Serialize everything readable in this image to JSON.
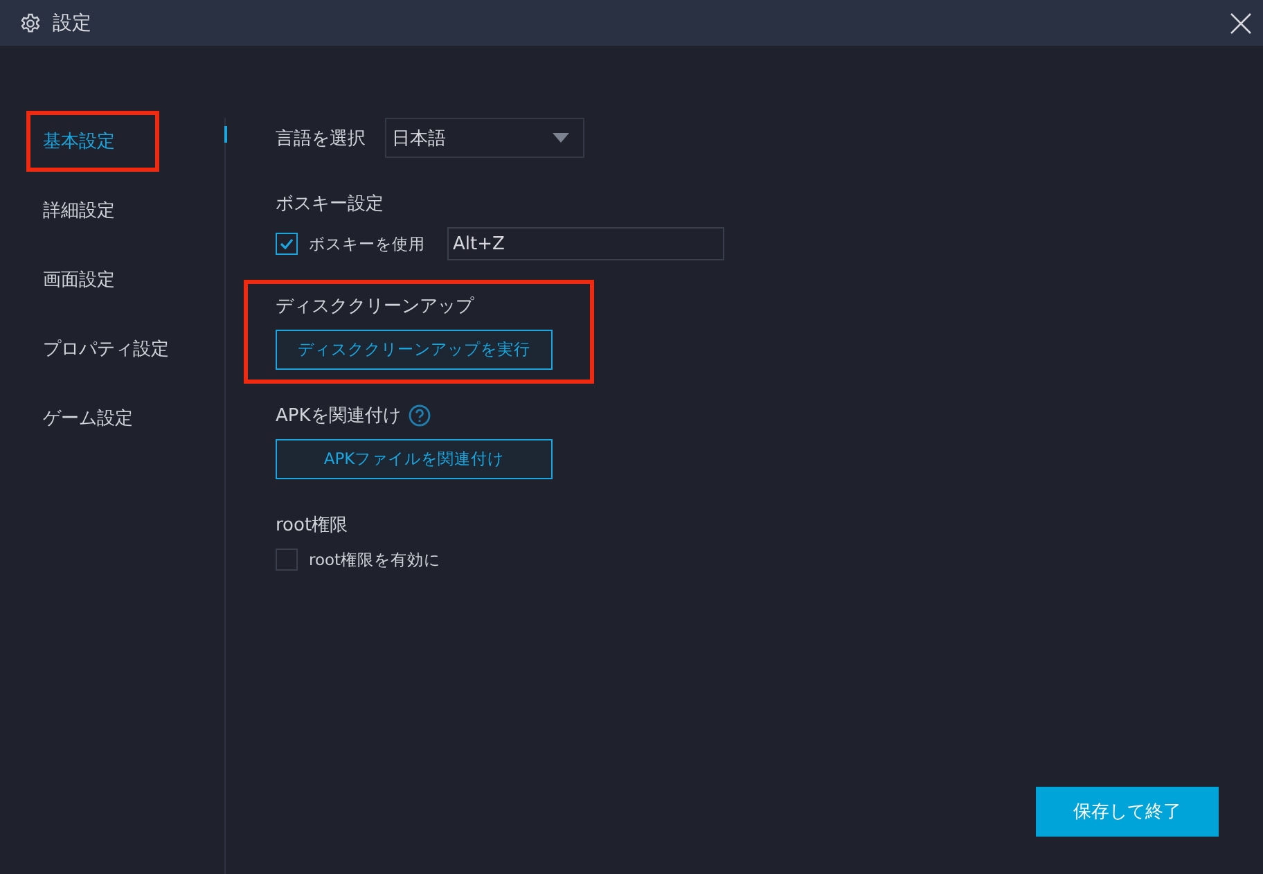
{
  "window": {
    "title": "設定"
  },
  "sidebar": {
    "items": [
      {
        "label": "基本設定",
        "selected": true,
        "highlighted": true
      },
      {
        "label": "詳細設定",
        "selected": false,
        "highlighted": false
      },
      {
        "label": "画面設定",
        "selected": false,
        "highlighted": false
      },
      {
        "label": "プロパティ設定",
        "selected": false,
        "highlighted": false
      },
      {
        "label": "ゲーム設定",
        "selected": false,
        "highlighted": false
      }
    ]
  },
  "language": {
    "label": "言語を選択",
    "value": "日本語"
  },
  "sections": [
    {
      "kind": "hotkey",
      "title": "ボスキー設定",
      "highlighted": false,
      "checkbox": {
        "label": "ボスキーを使用",
        "checked": true
      },
      "value": "Alt+Z"
    },
    {
      "kind": "button",
      "title": "ディスククリーンアップ",
      "highlighted": true,
      "help": false,
      "button": "ディスククリーンアップを実行"
    },
    {
      "kind": "button",
      "title": "APKを関連付け",
      "highlighted": false,
      "help": true,
      "button": "APKファイルを関連付け"
    },
    {
      "kind": "checkbox",
      "title": "root権限",
      "highlighted": false,
      "checkbox": {
        "label": "root権限を有効に",
        "checked": false
      }
    }
  ],
  "save_button": "保存して終了"
}
